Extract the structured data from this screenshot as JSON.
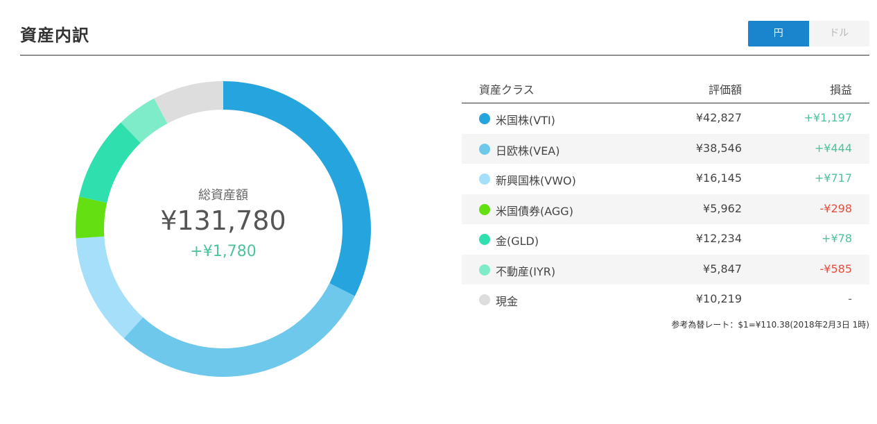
{
  "header": {
    "title": "資産内訳",
    "currency_options": [
      "円",
      "ドル"
    ],
    "active_currency": "円"
  },
  "summary": {
    "label": "総資産額",
    "total": "¥131,780",
    "gain": "+¥1,780"
  },
  "table": {
    "columns": [
      "資産クラス",
      "評価額",
      "損益"
    ],
    "rows": [
      {
        "name": "米国株(VTI)",
        "value": "¥42,827",
        "gain": "+¥1,197",
        "sign": "pos",
        "color": "#26a4dd"
      },
      {
        "name": "日欧株(VEA)",
        "value": "¥38,546",
        "gain": "+¥444",
        "sign": "pos",
        "color": "#6dc8ec"
      },
      {
        "name": "新興国株(VWO)",
        "value": "¥16,145",
        "gain": "+¥717",
        "sign": "pos",
        "color": "#a6dff9"
      },
      {
        "name": "米国債券(AGG)",
        "value": "¥5,962",
        "gain": "-¥298",
        "sign": "neg",
        "color": "#64e012"
      },
      {
        "name": "金(GLD)",
        "value": "¥12,234",
        "gain": "+¥78",
        "sign": "pos",
        "color": "#30dfae"
      },
      {
        "name": "不動産(IYR)",
        "value": "¥5,847",
        "gain": "-¥585",
        "sign": "neg",
        "color": "#7eecc9"
      },
      {
        "name": "現金",
        "value": "¥10,219",
        "gain": "-",
        "sign": "none",
        "color": "#dddddd"
      }
    ],
    "rate_note": "参考為替レート：$1=¥110.38(2018年2月3日 1時)"
  },
  "chart_data": {
    "type": "pie",
    "categories": [
      "米国株(VTI)",
      "日欧株(VEA)",
      "新興国株(VWO)",
      "米国債券(AGG)",
      "金(GLD)",
      "不動産(IYR)",
      "現金"
    ],
    "values": [
      42827,
      38546,
      16145,
      5962,
      12234,
      5847,
      10219
    ],
    "colors": [
      "#26a4dd",
      "#6dc8ec",
      "#a6dff9",
      "#64e012",
      "#30dfae",
      "#7eecc9",
      "#dddddd"
    ],
    "donut": true
  }
}
